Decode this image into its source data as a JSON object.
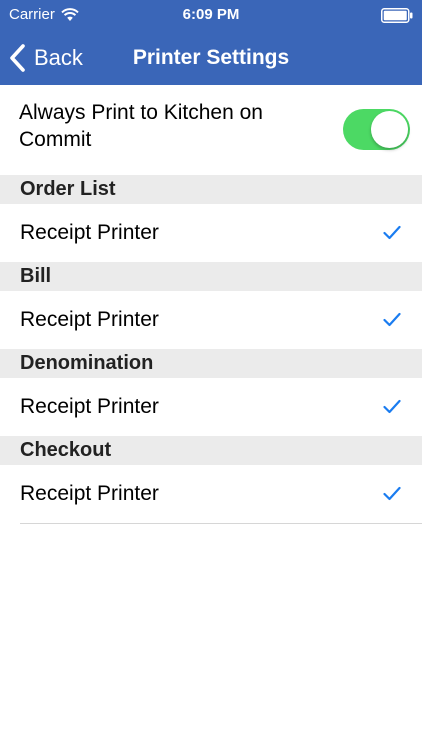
{
  "status_bar": {
    "carrier": "Carrier",
    "time": "6:09 PM"
  },
  "nav": {
    "back_label": "Back",
    "title": "Printer Settings"
  },
  "toggle": {
    "label": "Always Print to Kitchen on Commit",
    "on": true,
    "color": "#4cd964"
  },
  "sections": [
    {
      "header": "Order List",
      "option": "Receipt Printer",
      "selected": true
    },
    {
      "header": "Bill",
      "option": "Receipt Printer",
      "selected": true
    },
    {
      "header": "Denomination",
      "option": "Receipt Printer",
      "selected": true
    },
    {
      "header": "Checkout",
      "option": "Receipt Printer",
      "selected": true
    }
  ],
  "colors": {
    "nav_background": "#3a66b8",
    "check": "#1a7cf0",
    "section_background": "#ebebeb"
  },
  "icons": {
    "wifi": "wifi-icon",
    "battery": "battery-icon",
    "back": "chevron-left-icon",
    "check": "checkmark-icon"
  }
}
